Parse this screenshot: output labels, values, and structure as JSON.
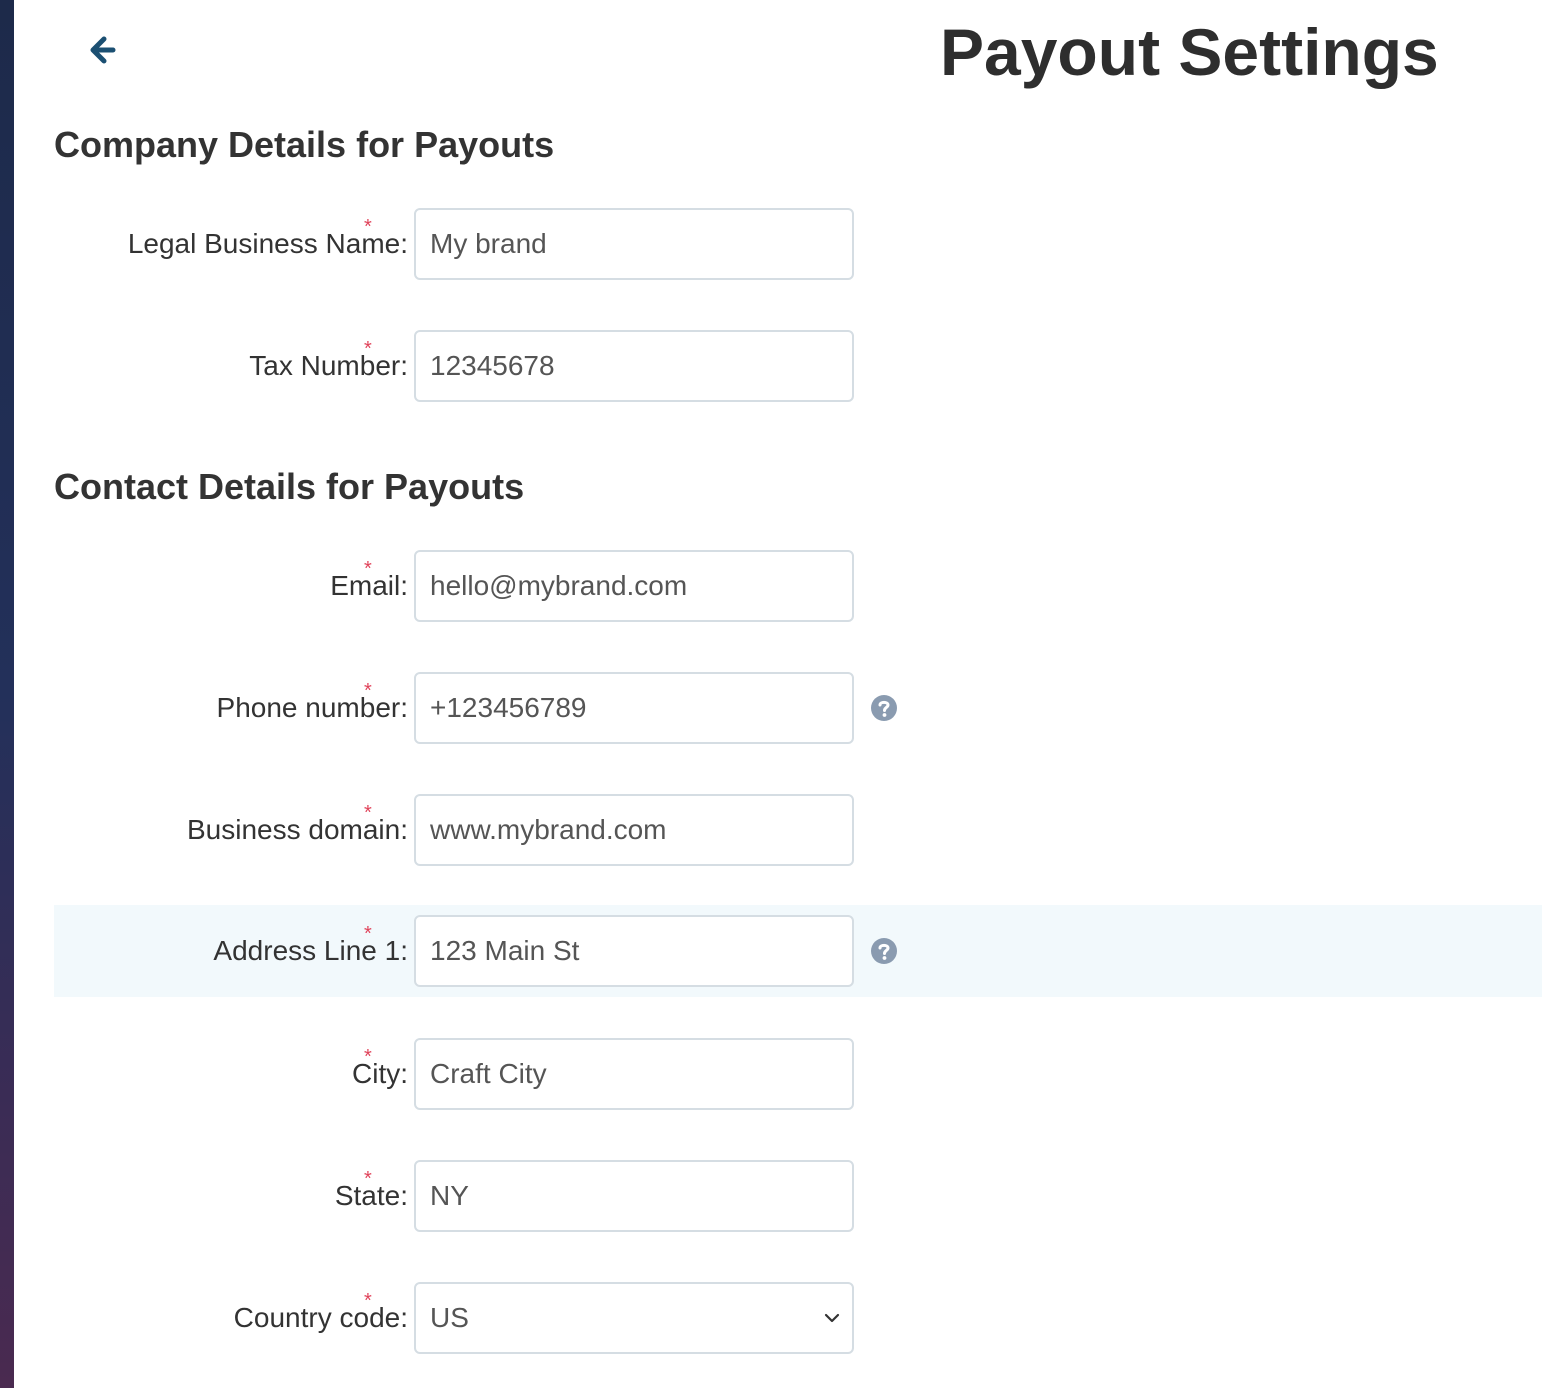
{
  "header": {
    "back_icon": "arrow-left-icon",
    "title": "Payout Settings"
  },
  "company_section": {
    "title": "Company Details for Payouts",
    "fields": [
      {
        "label": "Legal Business Name:",
        "value": "My brand"
      },
      {
        "label": "Tax Number:",
        "value": "12345678"
      }
    ]
  },
  "contact_section": {
    "title": "Contact Details for Payouts",
    "fields": [
      {
        "label": "Email:",
        "value": "hello@mybrand.com"
      },
      {
        "label": "Phone number:",
        "value": "+123456789",
        "help_icon": "question-circle-icon"
      },
      {
        "label": "Business domain:",
        "value": "www.mybrand.com"
      },
      {
        "label": "Address Line 1:",
        "value": "123 Main St",
        "help_icon": "question-circle-icon"
      },
      {
        "label": "City:",
        "value": "Craft City"
      },
      {
        "label": "State:",
        "value": "NY"
      },
      {
        "label": "Country code:",
        "value": "US",
        "type": "select"
      }
    ]
  },
  "required_marker": "*",
  "colors": {
    "accent": "#1b4f72",
    "required": "#e0435a",
    "highlight_row": "#f2f9fc",
    "help_icon": "#8a9bb0"
  }
}
